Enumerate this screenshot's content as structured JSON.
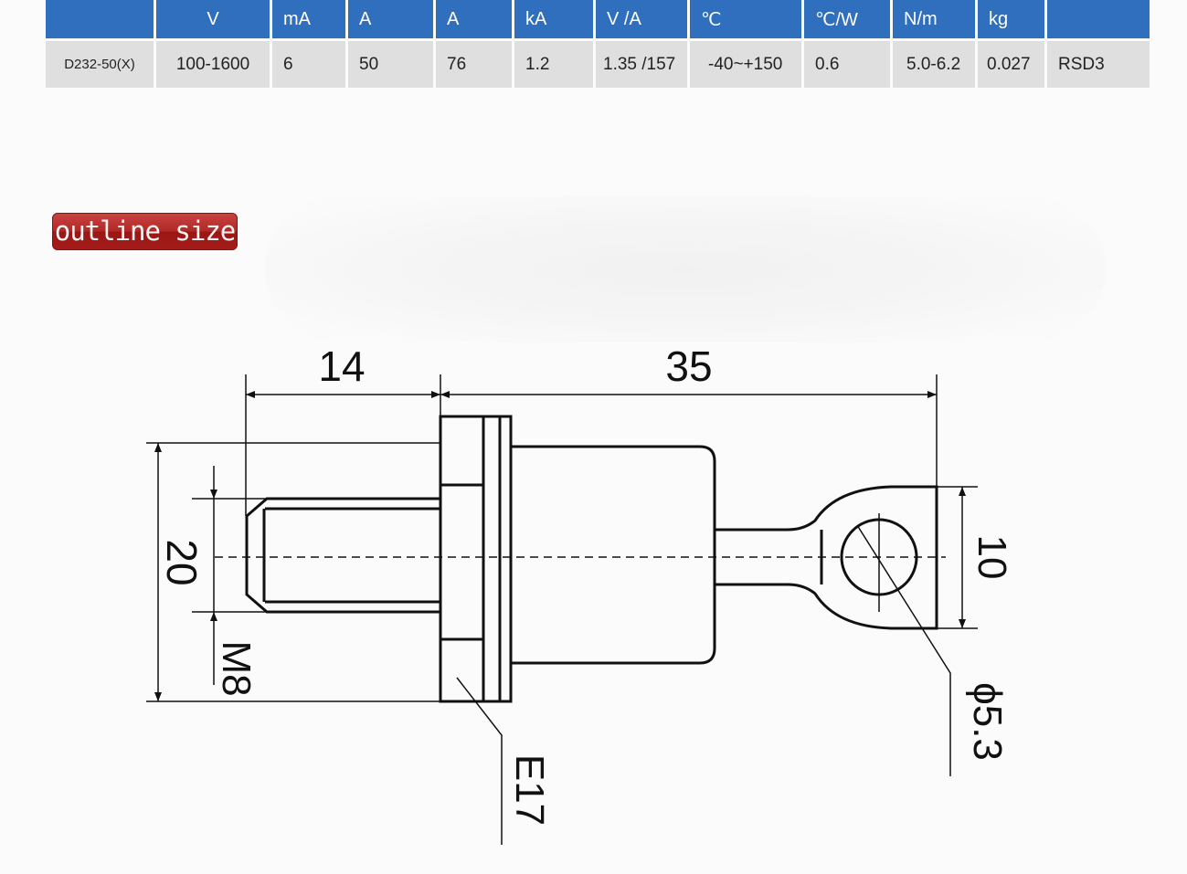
{
  "spec_table": {
    "headers": [
      "",
      "V",
      "mA",
      "A",
      "A",
      "kA",
      "V /A",
      "℃",
      "℃/W",
      "N/m",
      "kg",
      ""
    ],
    "rows": [
      [
        "D232-50(X)",
        "100-1600",
        "6",
        "50",
        "76",
        "1.2",
        "1.35 /157",
        "-40~+150",
        "0.6",
        "5.0-6.2",
        "0.027",
        "RSD3"
      ]
    ],
    "header_color": "#2f6fbd",
    "cell_color": "#dfdfdf"
  },
  "section": {
    "title": "outline size",
    "badge_color": "#b12a28"
  },
  "drawing": {
    "dimensions": {
      "stud_length": "14",
      "body_length": "35",
      "hex_height": "20",
      "thread": "M8",
      "hex_size": "E17",
      "terminal_width": "10",
      "hole_diameter": "ϕ5.3"
    }
  }
}
